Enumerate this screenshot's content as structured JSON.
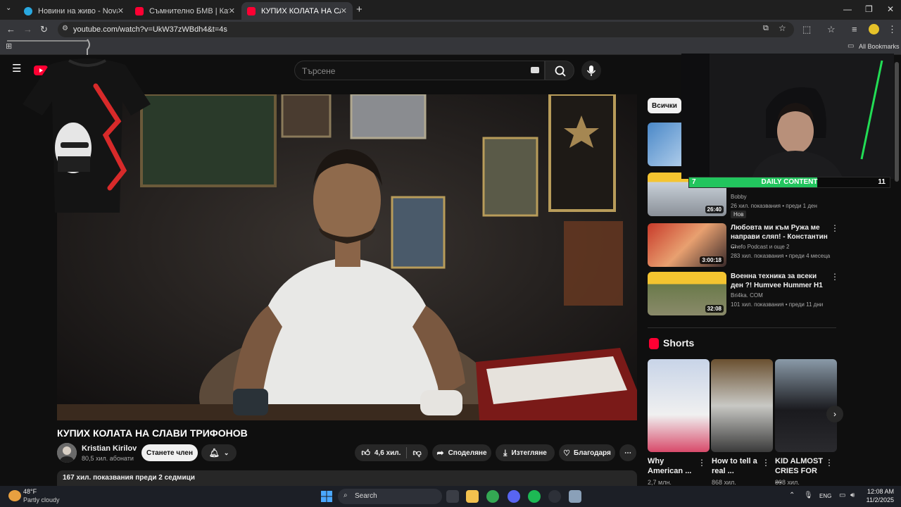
{
  "browser": {
    "tabs": [
      {
        "label": "Новини на живо - NovaPlay",
        "active": false,
        "icon": "novaplay-icon"
      },
      {
        "label": "Съмнително БМВ | Катаджии",
        "active": false,
        "icon": "youtube-icon"
      },
      {
        "label": "КУПИХ КОЛАТА НА СЛАВИ ТР",
        "active": true,
        "icon": "youtube-icon"
      }
    ],
    "url": "youtube.com/watch?v=UkW37zWBdh4&t=4s",
    "all_bookmarks": "All Bookmarks"
  },
  "youtube": {
    "search_placeholder": "Търсене",
    "video": {
      "title": "КУПИХ КОЛАТА НА СЛАВИ ТРИФОНОВ",
      "channel": "Kristian Kirilov",
      "subscribers": "80,5 хил. абонати",
      "join_label": "Станете член",
      "likes": "4,6 хил.",
      "share_label": "Споделяне",
      "download_label": "Изтегляне",
      "thanks_label": "Благодаря",
      "views_date": "167 хил. показвания  преди 2 седмици"
    },
    "sidebar": {
      "chip_all": "Всички",
      "recommendations": [
        {
          "title": "",
          "channel": "",
          "meta": "",
          "duration": "",
          "badge": ""
        },
        {
          "title": "",
          "channel": "Bobby",
          "meta": "26 хил. показвания • преди 1 ден",
          "duration": "26:40",
          "badge": "Нов"
        },
        {
          "title": "Любовта ми към Ружа ме направи сляп! - Константин ...",
          "channel": "Chefo Podcast и още 2",
          "meta": "283 хил. показвания • преди 4 месеца",
          "duration": "3:00:18",
          "badge": ""
        },
        {
          "title": "Военна техника за всеки ден ?! Humvee Hummer H1",
          "channel": "Bri4ka. COM",
          "meta": "101 хил. показвания • преди 11 дни",
          "duration": "32:08",
          "badge": ""
        }
      ],
      "shorts_heading": "Shorts",
      "shorts": [
        {
          "title": "Why American ...",
          "views": "2,7 млн."
        },
        {
          "title": "How to tell a real ...",
          "views": "868 хил."
        },
        {
          "title": "KID ALMOST CRIES FOR ...",
          "views": "898 хил."
        }
      ]
    }
  },
  "overlay": {
    "daily_left": "7",
    "daily_label": "DAILY CONTENT",
    "daily_right": "11",
    "daily_progress": 0.64
  },
  "taskbar": {
    "weather_temp": "48°F",
    "weather_desc": "Partly cloudy",
    "search_label": "Search",
    "lang": "ENG",
    "time": "12:08 AM",
    "date": "11/2/2025"
  },
  "colors": {
    "yt_red": "#ff0033",
    "daily_green": "#22c55e",
    "bg": "#0f0f0f"
  }
}
